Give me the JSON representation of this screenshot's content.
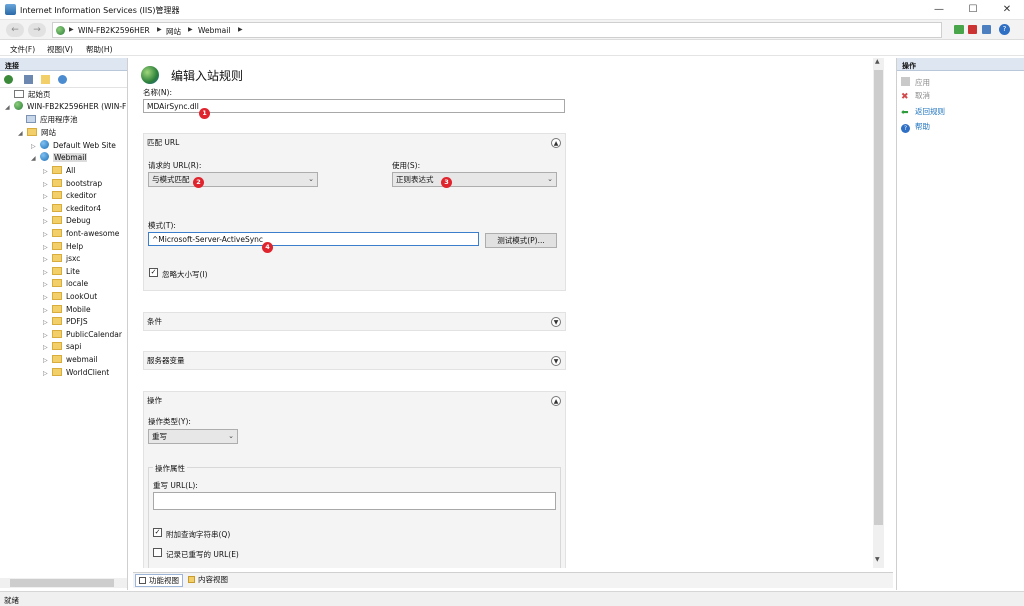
{
  "window": {
    "title": "Internet Information Services (IIS)管理器"
  },
  "address": {
    "crumbs": [
      "WIN-FB2K2596HER",
      "网站",
      "Webmail"
    ]
  },
  "menu": {
    "file": "文件(F)",
    "view": "视图(V)",
    "help": "帮助(H)"
  },
  "left": {
    "header": "连接",
    "tree": {
      "start": "起始页",
      "server": "WIN-FB2K2596HER (WIN-F",
      "apppools": "应用程序池",
      "sites": "网站",
      "default_site": "Default Web Site",
      "webmail": "Webmail",
      "folders": [
        "All",
        "bootstrap",
        "ckeditor",
        "ckeditor4",
        "Debug",
        "font-awesome",
        "Help",
        "jsxc",
        "Lite",
        "locale",
        "LookOut",
        "Mobile",
        "PDFJS",
        "PublicCalendar",
        "sapi",
        "webmail",
        "WorldClient"
      ]
    }
  },
  "main": {
    "title": "编辑入站规则",
    "name_label": "名称(N):",
    "name_value": "MDAirSync.dll",
    "match_section": "匹配 URL",
    "requested_url_label": "请求的 URL(R):",
    "requested_url_value": "与模式匹配",
    "using_label": "使用(S):",
    "using_value": "正则表达式",
    "pattern_label": "模式(T):",
    "pattern_value": "^Microsoft-Server-ActiveSync",
    "test_button": "测试模式(P)...",
    "ignore_case": "忽略大小写(I)",
    "conditions_section": "条件",
    "server_vars_section": "服务器变量",
    "action_section": "操作",
    "action_type_label": "操作类型(Y):",
    "action_type_value": "重写",
    "action_props": "操作属性",
    "rewrite_url_label": "重写 URL(L):",
    "rewrite_url_value": "",
    "append_query": "附加查询字符串(Q)",
    "log_rewritten": "记录已重写的 URL(E)"
  },
  "badges": [
    "1",
    "2",
    "3",
    "4"
  ],
  "view_tabs": {
    "features": "功能视图",
    "content": "内容视图"
  },
  "right": {
    "header": "操作",
    "apply": "应用",
    "cancel": "取消",
    "back": "返回规则",
    "help": "帮助"
  },
  "status": "就绪",
  "colors": {
    "accent": "#1e73be",
    "badge": "#e0242d",
    "panel_header": "#dde6f1"
  }
}
